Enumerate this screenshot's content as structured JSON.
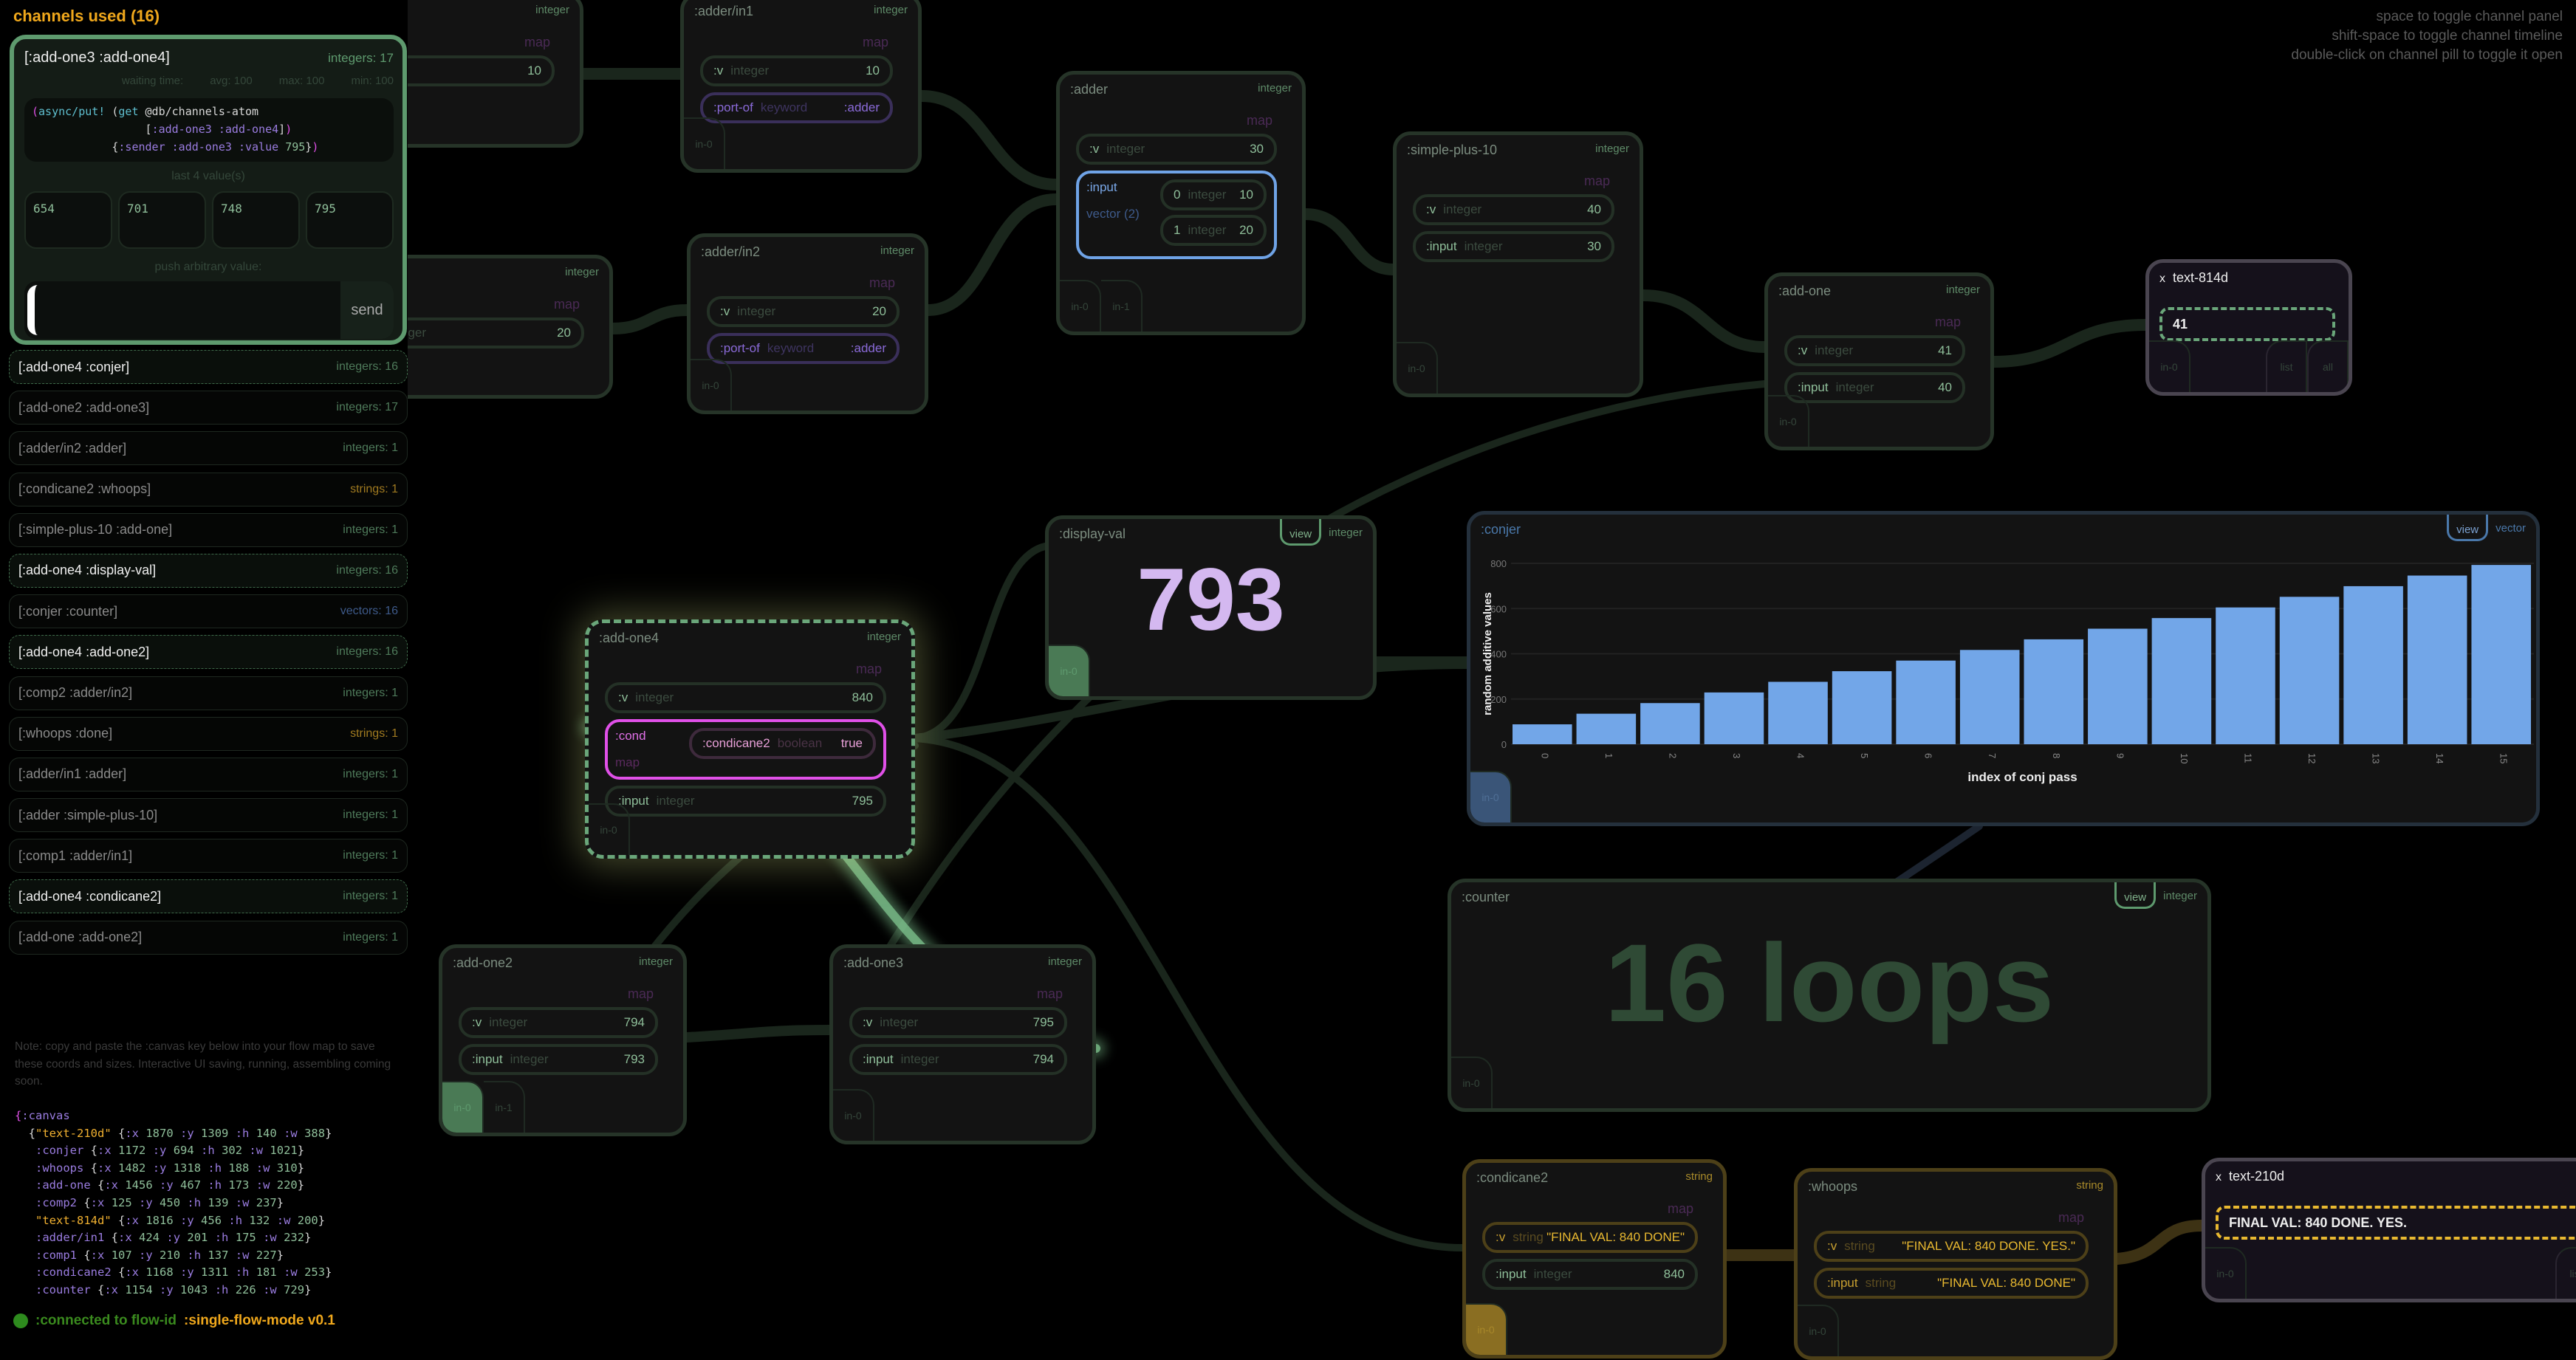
{
  "panel": {
    "title": "channels used (16)",
    "open_channel": {
      "name": "[:add-one3 :add-one4]",
      "count": "integers: 17",
      "waiting_label": "waiting time:",
      "avg": "avg: 100",
      "max": "max: 100",
      "min": "min: 100",
      "code_lines": [
        "(async/put! (get @db/channels-atom",
        "                 [:add-one3 :add-one4])",
        "            {:sender :add-one3 :value 795})"
      ],
      "last_label": "last 4 value(s)",
      "last_values": [
        "654",
        "701",
        "748",
        "795"
      ],
      "push_label": "push arbitrary value:",
      "push_value": "",
      "send_label": "send"
    },
    "channels": [
      {
        "name": "[:add-one4 :conjer]",
        "count": "integers: 16",
        "kind": "integers",
        "highlight": true
      },
      {
        "name": "[:add-one2 :add-one3]",
        "count": "integers: 17",
        "kind": "integers",
        "highlight": false
      },
      {
        "name": "[:adder/in2 :adder]",
        "count": "integers: 1",
        "kind": "integers",
        "highlight": false
      },
      {
        "name": "[:condicane2 :whoops]",
        "count": "strings: 1",
        "kind": "strings",
        "highlight": false
      },
      {
        "name": "[:simple-plus-10 :add-one]",
        "count": "integers: 1",
        "kind": "integers",
        "highlight": false
      },
      {
        "name": "[:add-one4 :display-val]",
        "count": "integers: 16",
        "kind": "integers",
        "highlight": true
      },
      {
        "name": "[:conjer :counter]",
        "count": "vectors: 16",
        "kind": "vectors",
        "highlight": false
      },
      {
        "name": "[:add-one4 :add-one2]",
        "count": "integers: 16",
        "kind": "integers",
        "highlight": true
      },
      {
        "name": "[:comp2 :adder/in2]",
        "count": "integers: 1",
        "kind": "integers",
        "highlight": false
      },
      {
        "name": "[:whoops :done]",
        "count": "strings: 1",
        "kind": "strings",
        "highlight": false
      },
      {
        "name": "[:adder/in1 :adder]",
        "count": "integers: 1",
        "kind": "integers",
        "highlight": false
      },
      {
        "name": "[:adder :simple-plus-10]",
        "count": "integers: 1",
        "kind": "integers",
        "highlight": false
      },
      {
        "name": "[:comp1 :adder/in1]",
        "count": "integers: 1",
        "kind": "integers",
        "highlight": false
      },
      {
        "name": "[:add-one4 :condicane2]",
        "count": "integers: 1",
        "kind": "integers",
        "highlight": true
      },
      {
        "name": "[:add-one :add-one2]",
        "count": "integers: 1",
        "kind": "integers",
        "highlight": false
      }
    ],
    "note": "Note: copy and paste the :canvas key below into your flow map to save these coords and sizes. Interactive UI saving, running, assembling coming soon.",
    "canvas_code": [
      "{:canvas",
      "  {\"text-210d\" {:x 1870 :y 1309 :h 140 :w 388}",
      "   :conjer {:x 1172 :y 694 :h 302 :w 1021}",
      "   :whoops {:x 1482 :y 1318 :h 188 :w 310}",
      "   :add-one {:x 1456 :y 467 :h 173 :w 220}",
      "   :comp2 {:x 125 :y 450 :h 139 :w 237}",
      "   \"text-814d\" {:x 1816 :y 456 :h 132 :w 200}",
      "   :adder/in1 {:x 424 :y 201 :h 175 :w 232}",
      "   :comp1 {:x 107 :y 210 :h 137 :w 227}",
      "   :condicane2 {:x 1168 :y 1311 :h 181 :w 253}",
      "   :counter {:x 1154 :y 1043 :h 226 :w 729}"
    ],
    "status_connected": ":connected to flow-id",
    "status_flow": ":single-flow-mode  v0.1",
    "status_color": "#2e8b1e"
  },
  "hints": [
    "space to toggle channel panel",
    "shift-space to toggle channel timeline",
    "double-click on channel pill to toggle it open"
  ],
  "nodes": [
    {
      "id": "comp1",
      "title": "",
      "type": "integer",
      "map": "map",
      "fields": [
        {
          "k": "",
          "t": "",
          "v": "10"
        }
      ],
      "ports": []
    },
    {
      "id": "comp2",
      "title": "",
      "type": "integer",
      "map": "map",
      "fields": [
        {
          "k": "",
          "t": "integer",
          "v": "20"
        }
      ],
      "ports": []
    },
    {
      "id": "adder-in1",
      "title": ":adder/in1",
      "type": "integer",
      "map": "map",
      "fields": [
        {
          "k": ":v",
          "t": "integer",
          "v": "10"
        },
        {
          "k": ":port-of",
          "t": "keyword",
          "v": ":adder",
          "style": "kw"
        }
      ],
      "ports": [
        {
          "l": "in-0"
        }
      ]
    },
    {
      "id": "adder-in2",
      "title": ":adder/in2",
      "type": "integer",
      "map": "map",
      "fields": [
        {
          "k": ":v",
          "t": "integer",
          "v": "20"
        },
        {
          "k": ":port-of",
          "t": "keyword",
          "v": ":adder",
          "style": "kw"
        }
      ],
      "ports": [
        {
          "l": "in-0"
        }
      ]
    },
    {
      "id": "adder",
      "title": ":adder",
      "type": "integer",
      "map": "map",
      "fields": [
        {
          "k": ":v",
          "t": "integer",
          "v": "30"
        },
        {
          "nest": "vector",
          "k": ":input",
          "sub": "vector (2)",
          "kids": [
            {
              "k": "0",
              "t": "integer",
              "v": "10"
            },
            {
              "k": "1",
              "t": "integer",
              "v": "20"
            }
          ]
        }
      ],
      "ports": [
        {
          "l": "in-0"
        },
        {
          "l": "in-1"
        }
      ]
    },
    {
      "id": "simple-plus-10",
      "title": ":simple-plus-10",
      "type": "integer",
      "map": "map",
      "fields": [
        {
          "k": ":v",
          "t": "integer",
          "v": "40"
        },
        {
          "k": ":input",
          "t": "integer",
          "v": "30"
        }
      ],
      "ports": [
        {
          "l": "in-0"
        }
      ]
    },
    {
      "id": "add-one",
      "title": ":add-one",
      "type": "integer",
      "map": "map",
      "fields": [
        {
          "k": ":v",
          "t": "integer",
          "v": "41"
        },
        {
          "k": ":input",
          "t": "integer",
          "v": "40"
        }
      ],
      "ports": [
        {
          "l": "in-0"
        }
      ]
    },
    {
      "id": "add-one4",
      "title": ":add-one4",
      "type": "integer",
      "map": "map",
      "variant": "sel",
      "fields": [
        {
          "k": ":v",
          "t": "integer",
          "v": "840"
        },
        {
          "nest": "mag",
          "k": ":cond",
          "sub": "map",
          "kids": [
            {
              "k": ":condicane2",
              "t": "boolean",
              "v": "true"
            }
          ]
        },
        {
          "k": ":input",
          "t": "integer",
          "v": "795"
        }
      ],
      "ports": [
        {
          "l": "in-0"
        }
      ]
    },
    {
      "id": "add-one2",
      "title": ":add-one2",
      "type": "integer",
      "map": "map",
      "fields": [
        {
          "k": ":v",
          "t": "integer",
          "v": "794"
        },
        {
          "k": ":input",
          "t": "integer",
          "v": "793"
        }
      ],
      "ports": [
        {
          "l": "in-0",
          "on": true
        },
        {
          "l": "in-1"
        }
      ]
    },
    {
      "id": "add-one3",
      "title": ":add-one3",
      "type": "integer",
      "map": "map",
      "fields": [
        {
          "k": ":v",
          "t": "integer",
          "v": "795"
        },
        {
          "k": ":input",
          "t": "integer",
          "v": "794"
        }
      ],
      "ports": [
        {
          "l": "in-0"
        }
      ]
    },
    {
      "id": "condicane2",
      "title": ":condicane2",
      "type": "string",
      "map": "map",
      "variant": "str",
      "fields": [
        {
          "k": ":v",
          "t": "string",
          "v": "\"FINAL VAL: 840 DONE\"",
          "style": "s"
        },
        {
          "k": ":input",
          "t": "integer",
          "v": "840"
        }
      ],
      "ports": [
        {
          "l": "in-0",
          "on": true
        }
      ]
    },
    {
      "id": "whoops",
      "title": ":whoops",
      "type": "string",
      "map": "map",
      "variant": "str",
      "fields": [
        {
          "k": ":v",
          "t": "string",
          "v": "\"FINAL VAL: 840 DONE. YES.\"",
          "style": "s"
        },
        {
          "k": ":input",
          "t": "string",
          "v": "\"FINAL VAL: 840 DONE\"",
          "style": "s"
        }
      ],
      "ports": [
        {
          "l": "in-0"
        }
      ]
    }
  ],
  "display_val": {
    "title": ":display-val",
    "view": "view",
    "type": "integer",
    "value": "793",
    "port": "in-0",
    "value_color": "#d4b8f0"
  },
  "counter": {
    "title": ":counter",
    "view": "view",
    "type": "integer",
    "value": "16 loops",
    "port": "in-0",
    "value_color": "#2f4a35"
  },
  "conjer": {
    "title": ":conjer",
    "view": "view",
    "type": "vector",
    "port": "in-0"
  },
  "text_nodes": [
    {
      "id": "text-814d",
      "close": "x",
      "title": "text-814d",
      "value": "41",
      "ports": [
        "in-0"
      ],
      "right_ports": [
        "list",
        "all"
      ],
      "box_color": "#6aa67a"
    },
    {
      "id": "text-210d",
      "close": "x",
      "title": "text-210d",
      "value": "FINAL VAL: 840 DONE. YES.",
      "ports": [
        "in-0"
      ],
      "right_ports": [
        "list"
      ],
      "box_color": "#e8b830"
    }
  ],
  "chart_data": {
    "type": "bar",
    "categories": [
      "0",
      "1",
      "2",
      "3",
      "4",
      "5",
      "6",
      "7",
      "8",
      "9",
      "10",
      "11",
      "12",
      "13",
      "14",
      "15"
    ],
    "values": [
      88,
      135,
      182,
      229,
      276,
      323,
      370,
      417,
      464,
      511,
      558,
      605,
      652,
      699,
      746,
      793
    ],
    "xlabel": "index of conj pass",
    "ylabel": "random additive values",
    "ylim": [
      0,
      800
    ],
    "yticks": [
      0,
      200,
      400,
      600,
      800
    ],
    "grid": true,
    "bar_color": "#72a6e8"
  },
  "colors": {
    "accent": "#f0a81c",
    "channel_green": "#5e9a6e",
    "wire": "#1a261c",
    "wire_active": "#7fc48f",
    "wire_string": "#3d3214"
  }
}
